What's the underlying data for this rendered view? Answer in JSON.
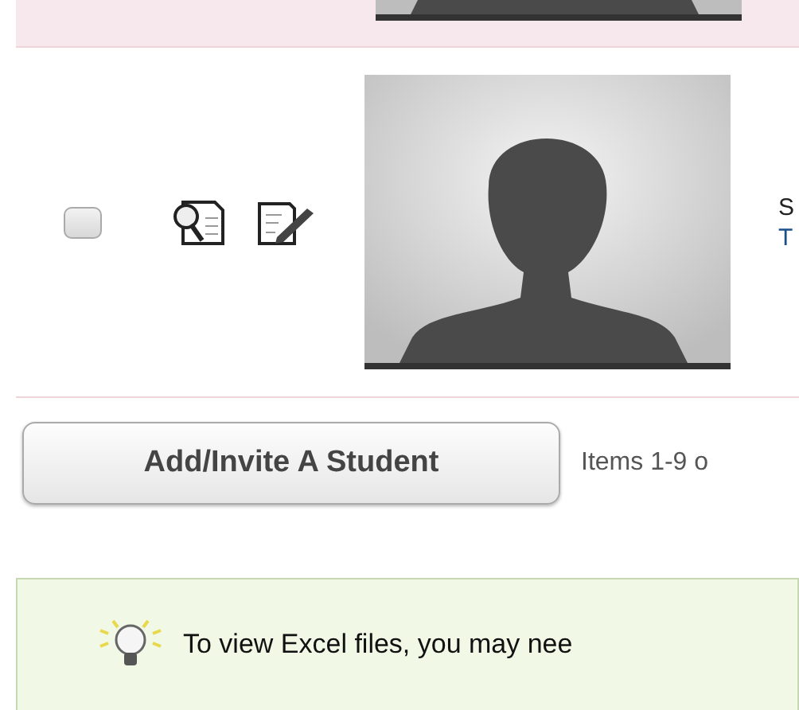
{
  "rows": [
    {
      "highlighted": true
    },
    {
      "highlighted": false,
      "checked": false,
      "lines": [
        "S",
        "T"
      ]
    }
  ],
  "add_button": "Add/Invite A Student",
  "pager": "Items 1-9 o",
  "notice": "To view Excel files, you may nee"
}
